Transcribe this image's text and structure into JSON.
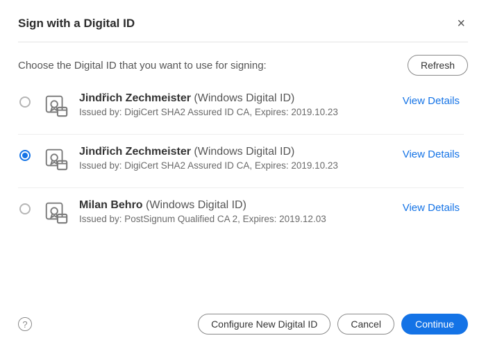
{
  "header": {
    "title": "Sign with a Digital ID",
    "close_label": "×"
  },
  "prompt": "Choose the Digital ID that you want to use for signing:",
  "refresh_label": "Refresh",
  "view_details_label": "View Details",
  "certificates": [
    {
      "selected": false,
      "name": "Jindřich Zechmeister",
      "type": "(Windows Digital ID)",
      "issuer": "Issued by: DigiCert SHA2 Assured ID CA, Expires: 2019.10.23"
    },
    {
      "selected": true,
      "name": "Jindřich Zechmeister",
      "type": "(Windows Digital ID)",
      "issuer": "Issued by: DigiCert SHA2 Assured ID CA, Expires: 2019.10.23"
    },
    {
      "selected": false,
      "name": "Milan Behro",
      "type": "(Windows Digital ID)",
      "issuer": "Issued by: PostSignum Qualified CA 2, Expires: 2019.12.03"
    }
  ],
  "footer": {
    "help_label": "?",
    "configure_label": "Configure New Digital ID",
    "cancel_label": "Cancel",
    "continue_label": "Continue"
  },
  "colors": {
    "accent": "#1473e6"
  }
}
